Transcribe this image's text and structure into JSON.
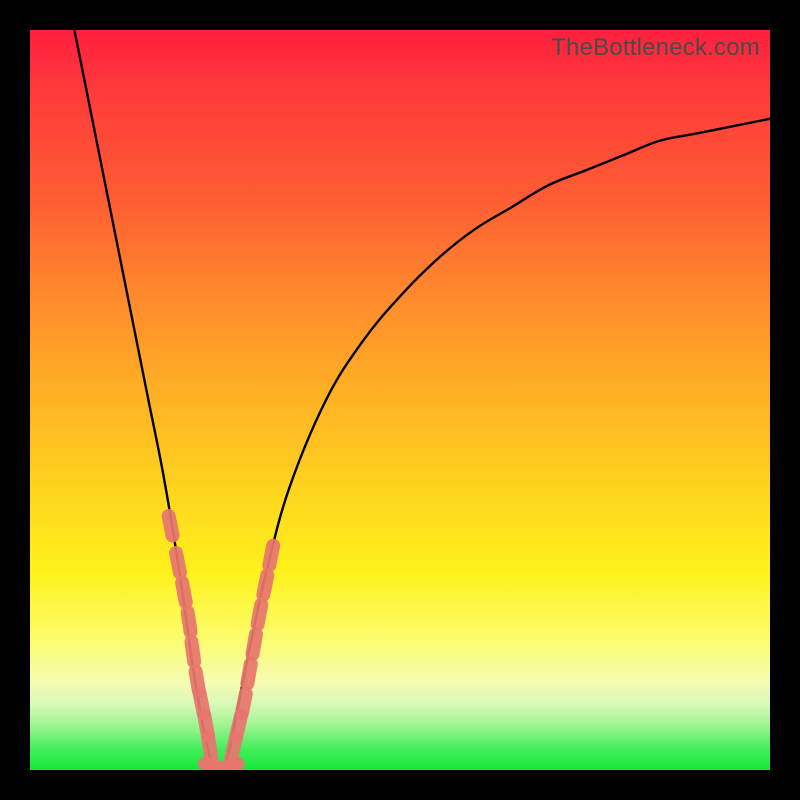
{
  "watermark": "TheBottleneck.com",
  "chart_data": {
    "type": "line",
    "title": "",
    "xlabel": "",
    "ylabel": "",
    "xlim": [
      0,
      100
    ],
    "ylim": [
      0,
      100
    ],
    "grid": false,
    "legend": false,
    "description": "V-shaped bottleneck curve on red-to-green vertical gradient. Y near 0 (green) is optimal; higher Y (red) is worse. Minimum of curve is around x≈25.",
    "series": [
      {
        "name": "bottleneck-curve",
        "color": "#000000",
        "x": [
          6,
          8,
          10,
          12,
          14,
          16,
          18,
          20,
          22,
          23,
          24,
          25,
          26,
          27,
          28,
          30,
          32,
          35,
          40,
          45,
          50,
          55,
          60,
          65,
          70,
          75,
          80,
          85,
          90,
          95,
          100
        ],
        "y": [
          100,
          90,
          80,
          70,
          60,
          50,
          40,
          28,
          14,
          8,
          3,
          0,
          0,
          3,
          8,
          18,
          27,
          38,
          50,
          58,
          64,
          69,
          73,
          76,
          79,
          81,
          83,
          85,
          86,
          87,
          88
        ]
      },
      {
        "name": "markers-left",
        "color": "#e8776e",
        "type": "scatter",
        "x": [
          19.0,
          20.0,
          20.8,
          21.5,
          22.0,
          22.6,
          23.2,
          23.8,
          24.3
        ],
        "y": [
          33,
          28,
          24,
          20,
          16,
          12,
          9,
          6,
          3
        ]
      },
      {
        "name": "markers-bottom",
        "color": "#e8776e",
        "type": "scatter",
        "x": [
          24.8,
          25.5,
          26.2,
          26.9
        ],
        "y": [
          0.5,
          0.3,
          0.3,
          0.5
        ]
      },
      {
        "name": "markers-right",
        "color": "#e8776e",
        "type": "scatter",
        "x": [
          27.5,
          28.2,
          28.9,
          29.6,
          30.3,
          31.0,
          31.8,
          32.6
        ],
        "y": [
          3,
          6,
          9,
          13,
          17,
          21,
          25,
          29
        ]
      }
    ]
  }
}
